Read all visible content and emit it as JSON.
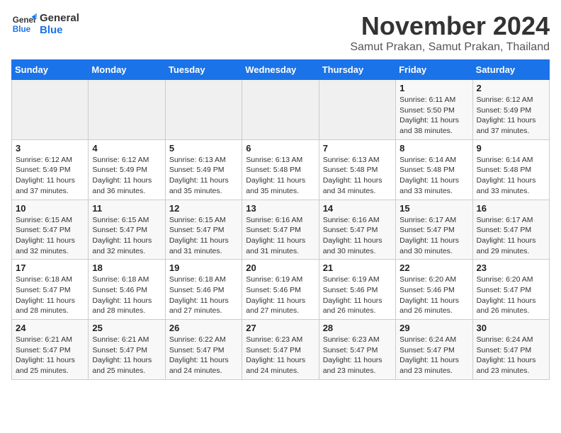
{
  "logo": {
    "line1": "General",
    "line2": "Blue"
  },
  "title": "November 2024",
  "location": "Samut Prakan, Samut Prakan, Thailand",
  "days_of_week": [
    "Sunday",
    "Monday",
    "Tuesday",
    "Wednesday",
    "Thursday",
    "Friday",
    "Saturday"
  ],
  "weeks": [
    [
      {
        "day": "",
        "info": ""
      },
      {
        "day": "",
        "info": ""
      },
      {
        "day": "",
        "info": ""
      },
      {
        "day": "",
        "info": ""
      },
      {
        "day": "",
        "info": ""
      },
      {
        "day": "1",
        "info": "Sunrise: 6:11 AM\nSunset: 5:50 PM\nDaylight: 11 hours\nand 38 minutes."
      },
      {
        "day": "2",
        "info": "Sunrise: 6:12 AM\nSunset: 5:49 PM\nDaylight: 11 hours\nand 37 minutes."
      }
    ],
    [
      {
        "day": "3",
        "info": "Sunrise: 6:12 AM\nSunset: 5:49 PM\nDaylight: 11 hours\nand 37 minutes."
      },
      {
        "day": "4",
        "info": "Sunrise: 6:12 AM\nSunset: 5:49 PM\nDaylight: 11 hours\nand 36 minutes."
      },
      {
        "day": "5",
        "info": "Sunrise: 6:13 AM\nSunset: 5:49 PM\nDaylight: 11 hours\nand 35 minutes."
      },
      {
        "day": "6",
        "info": "Sunrise: 6:13 AM\nSunset: 5:48 PM\nDaylight: 11 hours\nand 35 minutes."
      },
      {
        "day": "7",
        "info": "Sunrise: 6:13 AM\nSunset: 5:48 PM\nDaylight: 11 hours\nand 34 minutes."
      },
      {
        "day": "8",
        "info": "Sunrise: 6:14 AM\nSunset: 5:48 PM\nDaylight: 11 hours\nand 33 minutes."
      },
      {
        "day": "9",
        "info": "Sunrise: 6:14 AM\nSunset: 5:48 PM\nDaylight: 11 hours\nand 33 minutes."
      }
    ],
    [
      {
        "day": "10",
        "info": "Sunrise: 6:15 AM\nSunset: 5:47 PM\nDaylight: 11 hours\nand 32 minutes."
      },
      {
        "day": "11",
        "info": "Sunrise: 6:15 AM\nSunset: 5:47 PM\nDaylight: 11 hours\nand 32 minutes."
      },
      {
        "day": "12",
        "info": "Sunrise: 6:15 AM\nSunset: 5:47 PM\nDaylight: 11 hours\nand 31 minutes."
      },
      {
        "day": "13",
        "info": "Sunrise: 6:16 AM\nSunset: 5:47 PM\nDaylight: 11 hours\nand 31 minutes."
      },
      {
        "day": "14",
        "info": "Sunrise: 6:16 AM\nSunset: 5:47 PM\nDaylight: 11 hours\nand 30 minutes."
      },
      {
        "day": "15",
        "info": "Sunrise: 6:17 AM\nSunset: 5:47 PM\nDaylight: 11 hours\nand 30 minutes."
      },
      {
        "day": "16",
        "info": "Sunrise: 6:17 AM\nSunset: 5:47 PM\nDaylight: 11 hours\nand 29 minutes."
      }
    ],
    [
      {
        "day": "17",
        "info": "Sunrise: 6:18 AM\nSunset: 5:47 PM\nDaylight: 11 hours\nand 28 minutes."
      },
      {
        "day": "18",
        "info": "Sunrise: 6:18 AM\nSunset: 5:46 PM\nDaylight: 11 hours\nand 28 minutes."
      },
      {
        "day": "19",
        "info": "Sunrise: 6:18 AM\nSunset: 5:46 PM\nDaylight: 11 hours\nand 27 minutes."
      },
      {
        "day": "20",
        "info": "Sunrise: 6:19 AM\nSunset: 5:46 PM\nDaylight: 11 hours\nand 27 minutes."
      },
      {
        "day": "21",
        "info": "Sunrise: 6:19 AM\nSunset: 5:46 PM\nDaylight: 11 hours\nand 26 minutes."
      },
      {
        "day": "22",
        "info": "Sunrise: 6:20 AM\nSunset: 5:46 PM\nDaylight: 11 hours\nand 26 minutes."
      },
      {
        "day": "23",
        "info": "Sunrise: 6:20 AM\nSunset: 5:47 PM\nDaylight: 11 hours\nand 26 minutes."
      }
    ],
    [
      {
        "day": "24",
        "info": "Sunrise: 6:21 AM\nSunset: 5:47 PM\nDaylight: 11 hours\nand 25 minutes."
      },
      {
        "day": "25",
        "info": "Sunrise: 6:21 AM\nSunset: 5:47 PM\nDaylight: 11 hours\nand 25 minutes."
      },
      {
        "day": "26",
        "info": "Sunrise: 6:22 AM\nSunset: 5:47 PM\nDaylight: 11 hours\nand 24 minutes."
      },
      {
        "day": "27",
        "info": "Sunrise: 6:23 AM\nSunset: 5:47 PM\nDaylight: 11 hours\nand 24 minutes."
      },
      {
        "day": "28",
        "info": "Sunrise: 6:23 AM\nSunset: 5:47 PM\nDaylight: 11 hours\nand 23 minutes."
      },
      {
        "day": "29",
        "info": "Sunrise: 6:24 AM\nSunset: 5:47 PM\nDaylight: 11 hours\nand 23 minutes."
      },
      {
        "day": "30",
        "info": "Sunrise: 6:24 AM\nSunset: 5:47 PM\nDaylight: 11 hours\nand 23 minutes."
      }
    ]
  ]
}
